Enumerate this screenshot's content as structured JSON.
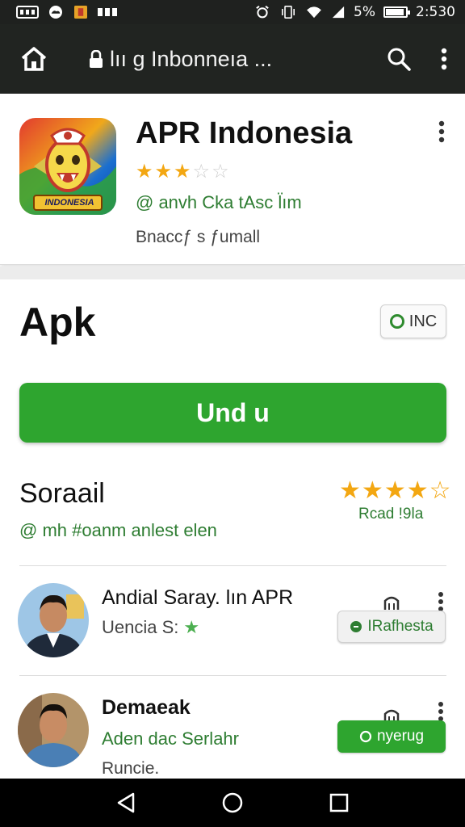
{
  "status_bar": {
    "signal_text": "5%",
    "time": "2:530"
  },
  "toolbar": {
    "url": "lıı g Inbonneıa ...",
    "icons": [
      "home-icon",
      "lock-icon",
      "search-icon",
      "more-vert-icon"
    ]
  },
  "app": {
    "title": "APR Indonesia",
    "icon_label": "INDONESIA",
    "rating_stars": 3,
    "developer": "@ anvh Cka tAsc l̈ım",
    "size": "Bnaccƒ s ƒumall"
  },
  "apk": {
    "title": "Apk",
    "badge_label": "INC",
    "download_label": "Und u"
  },
  "rating": {
    "title": "Soraail",
    "subtitle": "@ mh #oanm anlest elen",
    "stars": 4,
    "label": "Rcad !9la"
  },
  "reviews": [
    {
      "name": "Andial Saray. lın APR",
      "subtitle": "Uencia S:",
      "chip_label": "IRafhesta",
      "chip_style": "light"
    },
    {
      "name": "Demaeak",
      "subtitle": "Aden dac Serlahr",
      "extra": "Runcie.",
      "chip_label": "nyerug",
      "chip_style": "green"
    }
  ],
  "colors": {
    "accent_green": "#2ea52f",
    "text_green": "#2e7d32",
    "star_gold": "#f3a712",
    "toolbar_dark": "#212421"
  }
}
